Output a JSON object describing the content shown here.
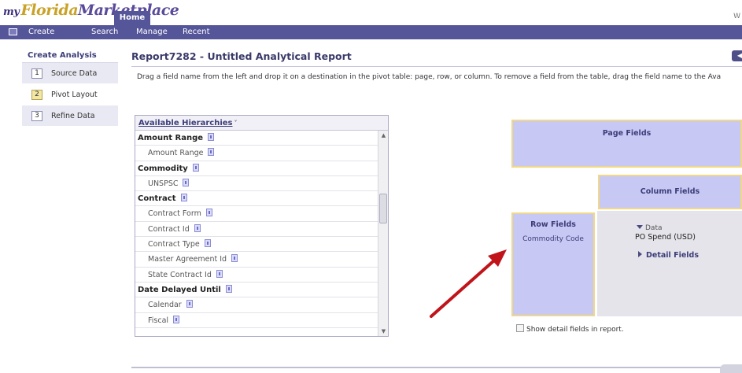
{
  "brand": {
    "logo_prefix": "my",
    "logo_mid": "Florida",
    "logo_suffix": "Marketplace",
    "home_tab": "Home",
    "right_text": "W"
  },
  "nav": {
    "create": "Create",
    "search": "Search",
    "manage": "Manage",
    "recent": "Recent"
  },
  "left_panel": {
    "title": "Create Analysis",
    "steps": [
      {
        "num": "1",
        "label": "Source Data"
      },
      {
        "num": "2",
        "label": "Pivot Layout"
      },
      {
        "num": "3",
        "label": "Refine Data"
      }
    ]
  },
  "report": {
    "title": "Report7282 - Untitled Analytical Report",
    "instructions": "Drag a field name from the left and drop it on a destination in the pivot table: page, row, or column. To remove a field from the table, drag the field name to the Ava"
  },
  "hierarchies": {
    "header": "Available Hierarchies",
    "caret": "˅",
    "groups": [
      {
        "name": "Amount Range",
        "items": [
          "Amount Range"
        ]
      },
      {
        "name": "Commodity",
        "items": [
          "UNSPSC"
        ]
      },
      {
        "name": "Contract",
        "items": [
          "Contract Form",
          "Contract Id",
          "Contract Type",
          "Master Agreement Id",
          "State Contract Id"
        ]
      },
      {
        "name": "Date Delayed Until",
        "items": [
          "Calendar",
          "Fiscal"
        ]
      }
    ]
  },
  "pivot": {
    "page_fields": "Page Fields",
    "column_fields": "Column Fields",
    "row_fields": "Row Fields",
    "row_value": "Commodity Code",
    "data_label": "Data",
    "data_value": "PO Spend (USD)",
    "detail_fields": "Detail Fields",
    "show_detail": "Show detail fields in report."
  },
  "colors": {
    "nav_bg": "#55559a",
    "drop_zone": "#c8c8f4",
    "drop_zone_border": "#f0d888",
    "arrow": "#c0141a"
  }
}
